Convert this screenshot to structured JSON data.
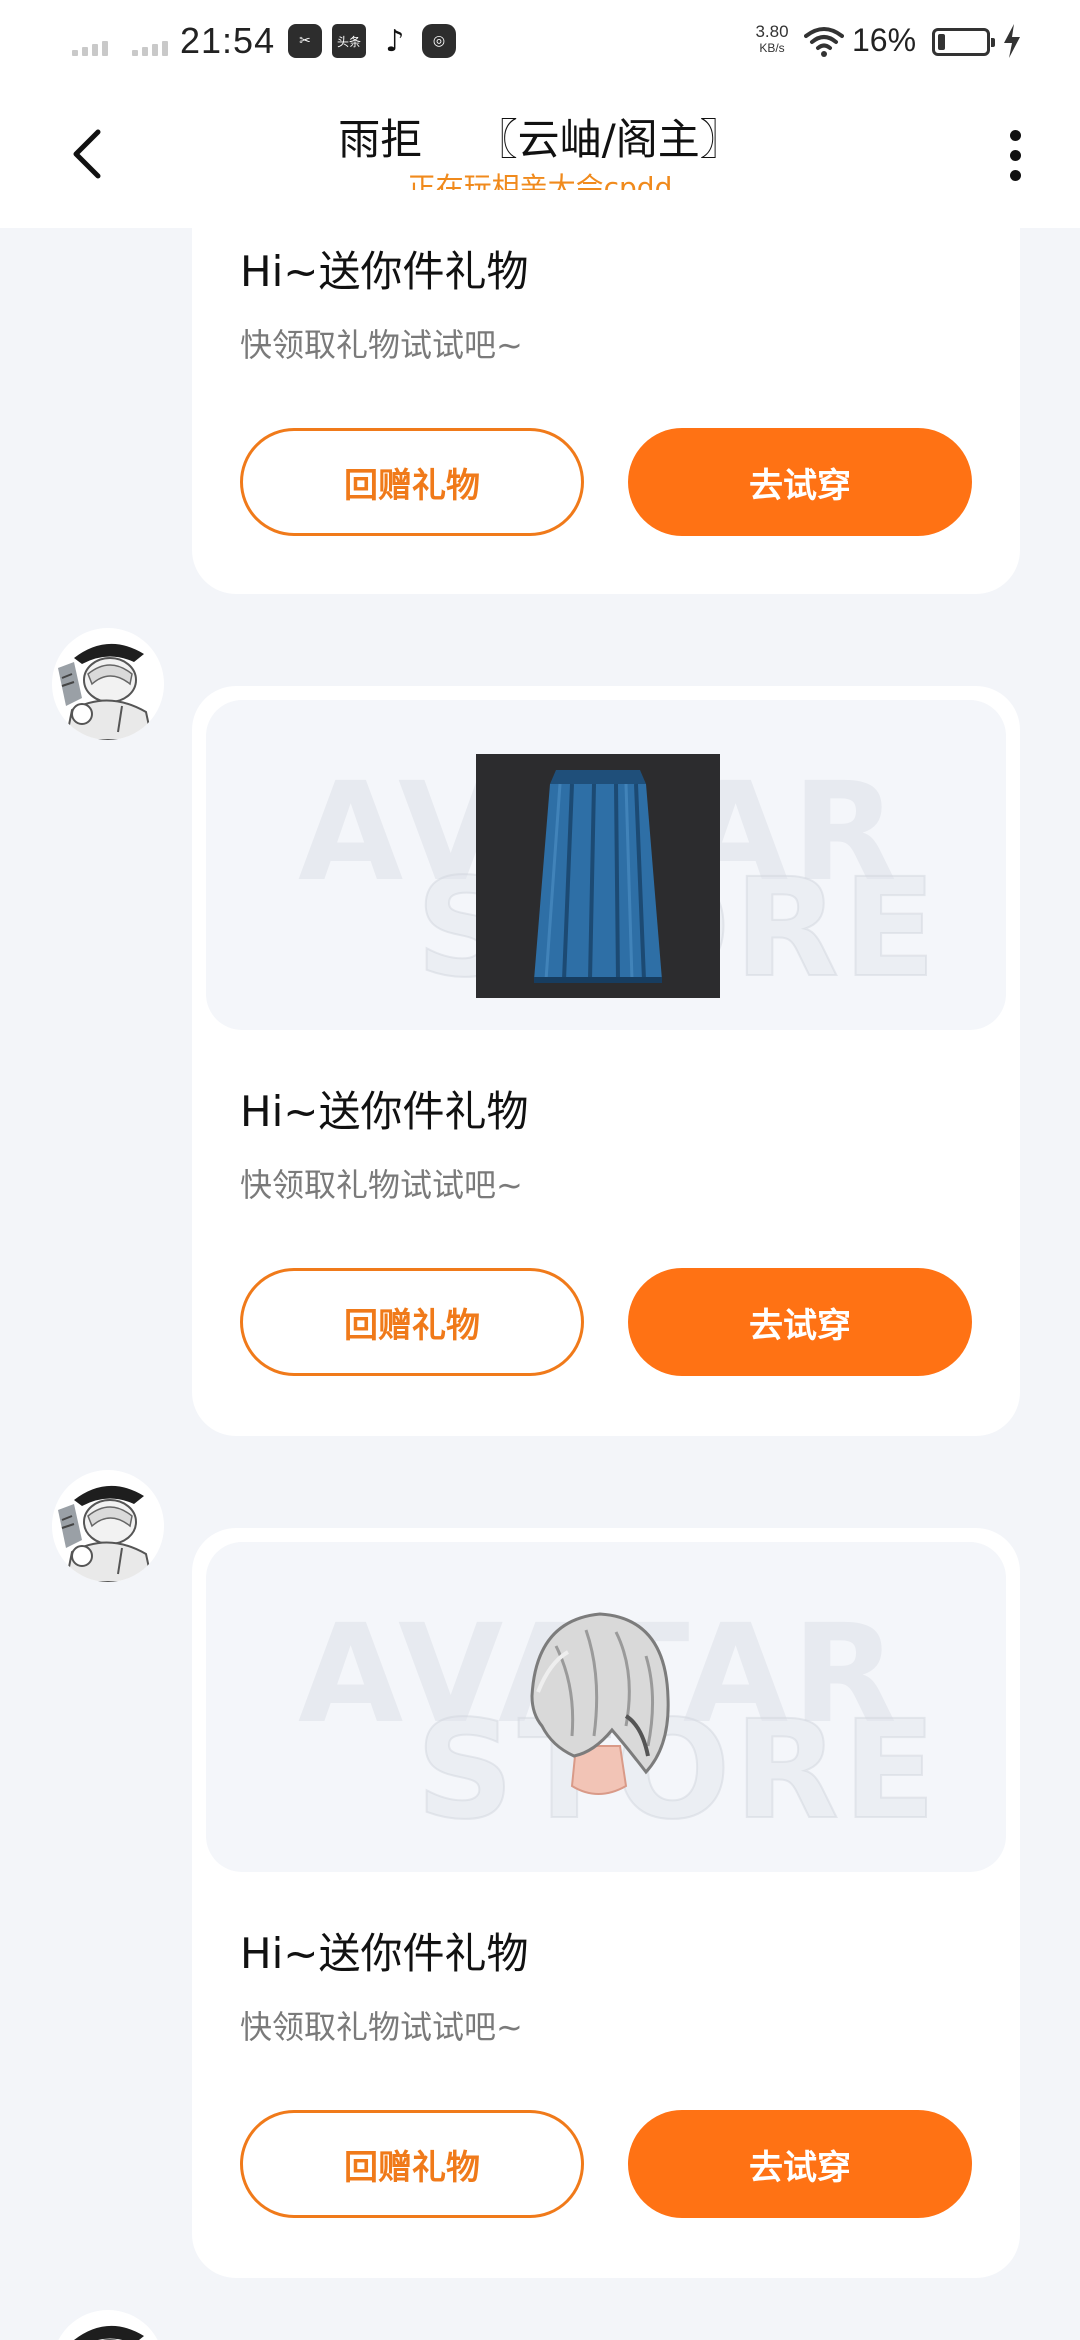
{
  "status_bar": {
    "time": "21:54",
    "app_icons": [
      "scissors-app-icon",
      "toutiao-app-icon",
      "tiktok-app-icon",
      "chat-app-icon"
    ],
    "toutiao_label": "头条",
    "net_speed": "3.80",
    "net_unit": "KB/s",
    "battery_pct": "16%"
  },
  "header": {
    "title": "雨拒    〖云岫/阁主〗",
    "subtitle": "正在玩相亲大会cpdd"
  },
  "messages": [
    {
      "title": "Hi~送你件礼物",
      "desc": "快领取礼物试试吧~",
      "btn_return": "回赠礼物",
      "btn_try": "去试穿"
    },
    {
      "title": "Hi~送你件礼物",
      "desc": "快领取礼物试试吧~",
      "btn_return": "回赠礼物",
      "btn_try": "去试穿",
      "item": "blue-skirt"
    },
    {
      "title": "Hi~送你件礼物",
      "desc": "快领取礼物试试吧~",
      "btn_return": "回赠礼物",
      "btn_try": "去试穿",
      "item": "silver-hair"
    }
  ],
  "watermark": {
    "line1": "AVATAR",
    "line2": "STORE"
  },
  "colors": {
    "accent": "#ff7214",
    "subtitle": "#f08a1c",
    "background": "#f3f5f9"
  }
}
